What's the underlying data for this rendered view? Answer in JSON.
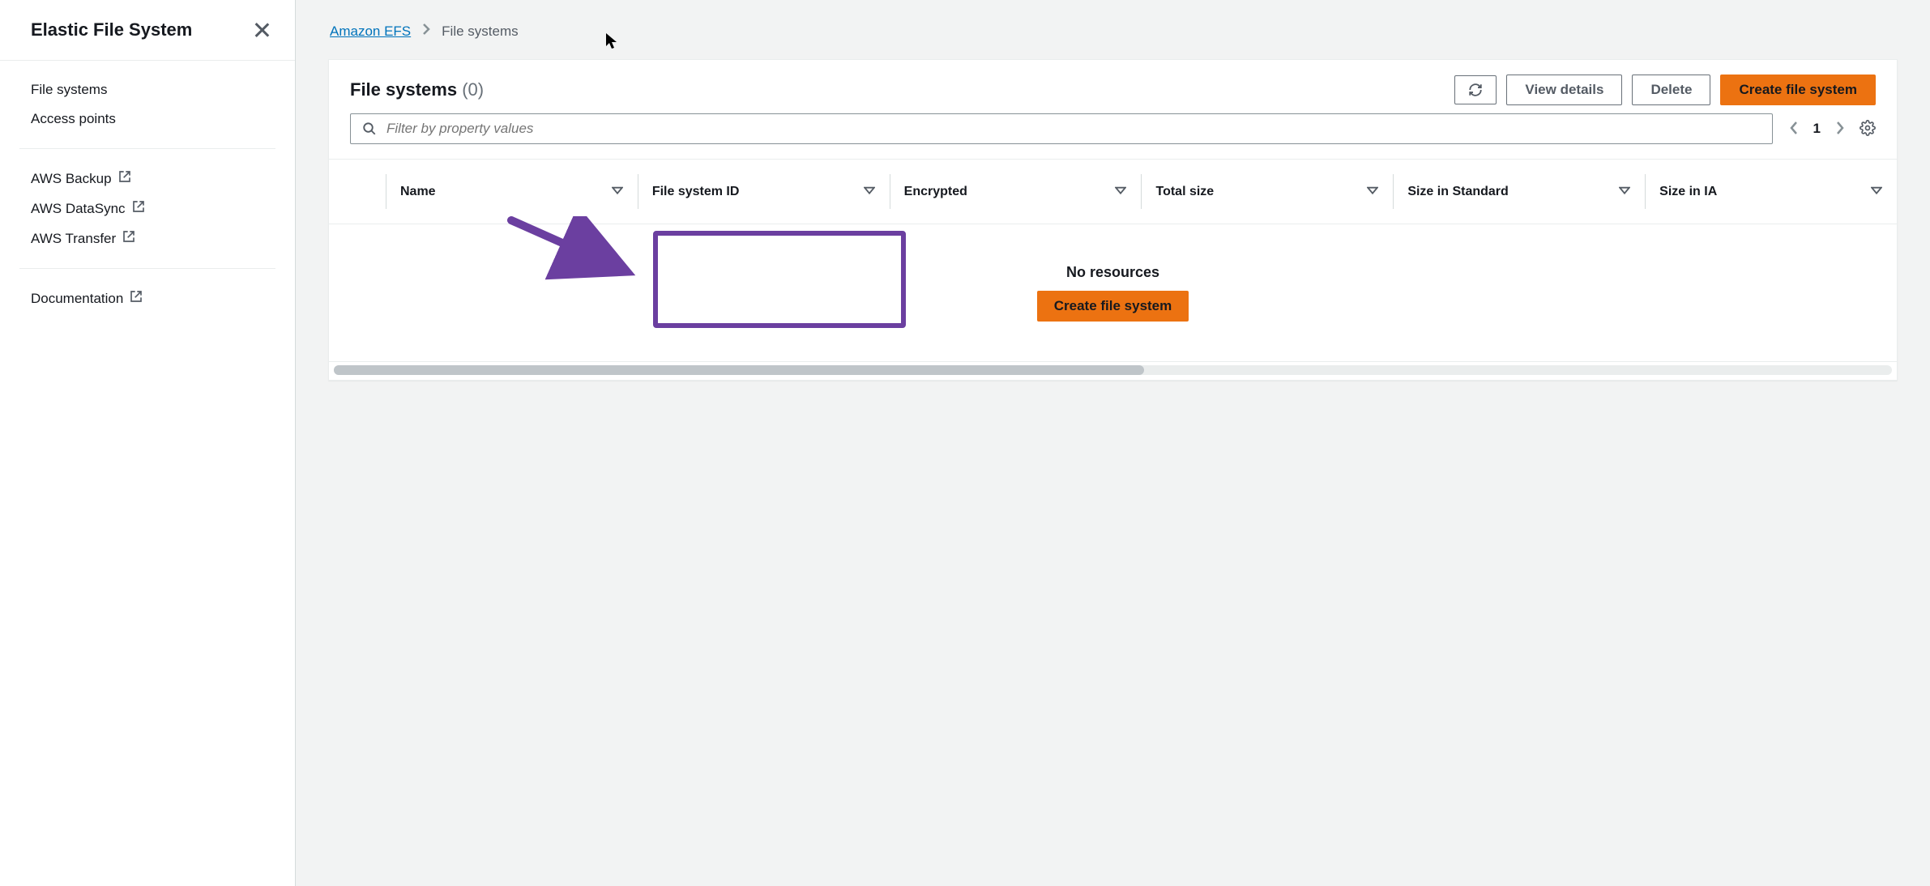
{
  "sidebar": {
    "title": "Elastic File System",
    "nav1": [
      {
        "label": "File systems"
      },
      {
        "label": "Access points"
      }
    ],
    "nav2": [
      {
        "label": "AWS Backup"
      },
      {
        "label": "AWS DataSync"
      },
      {
        "label": "AWS Transfer"
      }
    ],
    "nav3": [
      {
        "label": "Documentation"
      }
    ]
  },
  "breadcrumb": {
    "root": "Amazon EFS",
    "current": "File systems"
  },
  "panel": {
    "title": "File systems",
    "count": "(0)",
    "actions": {
      "view_details": "View details",
      "delete": "Delete",
      "create": "Create file system"
    },
    "filter_placeholder": "Filter by property values",
    "page": "1"
  },
  "columns": [
    "Name",
    "File system ID",
    "Encrypted",
    "Total size",
    "Size in Standard",
    "Size in IA"
  ],
  "empty": {
    "message": "No resources",
    "cta": "Create file system"
  }
}
